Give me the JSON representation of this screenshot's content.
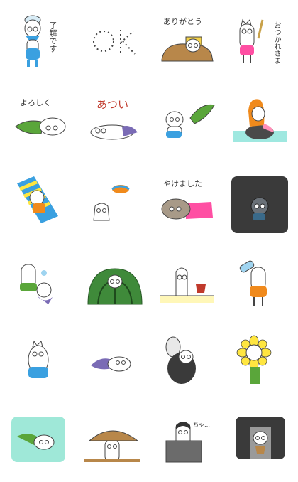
{
  "stickers": {
    "s1_text": "了解です",
    "s3_text": "ありがとう",
    "s4_text": "おつかれさま",
    "s5_text": "よろしく",
    "s6_text": "あつい",
    "s11_text": "やけました",
    "s23_text": "ちゃ…",
    "s2_text": "OK"
  },
  "colors": {
    "blue": "#3aa0e0",
    "pink": "#ff4fa3",
    "green": "#5aa63a",
    "orange": "#f08a1c",
    "purple": "#7a6bb5",
    "teal": "#9fe8e0",
    "dark": "#3a3a3a",
    "brown": "#b8874a",
    "yellow": "#ffe640"
  }
}
